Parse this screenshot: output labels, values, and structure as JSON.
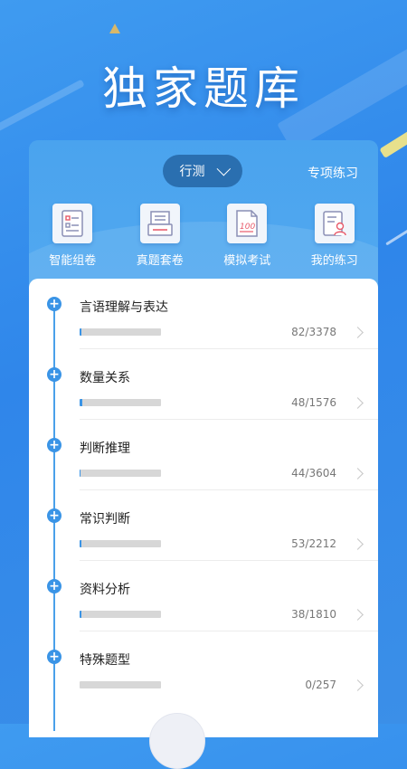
{
  "hero": {
    "title": "独家题库"
  },
  "header": {
    "exam_selector": "行测",
    "special_practice": "专项练习"
  },
  "quick_actions": [
    {
      "label": "智能组卷",
      "icon": "smart-paper-icon"
    },
    {
      "label": "真题套卷",
      "icon": "past-papers-icon"
    },
    {
      "label": "模拟考试",
      "icon": "mock-exam-icon"
    },
    {
      "label": "我的练习",
      "icon": "my-practice-icon"
    }
  ],
  "topics": [
    {
      "name": "言语理解与表达",
      "count": "82/3378",
      "progress": 0.024
    },
    {
      "name": "数量关系",
      "count": "48/1576",
      "progress": 0.03
    },
    {
      "name": "判断推理",
      "count": "44/3604",
      "progress": 0.012
    },
    {
      "name": "常识判断",
      "count": "53/2212",
      "progress": 0.024
    },
    {
      "name": "资料分析",
      "count": "38/1810",
      "progress": 0.021
    },
    {
      "name": "特殊题型",
      "count": "0/257",
      "progress": 0
    }
  ],
  "colors": {
    "accent": "#3a94e6",
    "selector_bg": "#2a6fb0"
  }
}
